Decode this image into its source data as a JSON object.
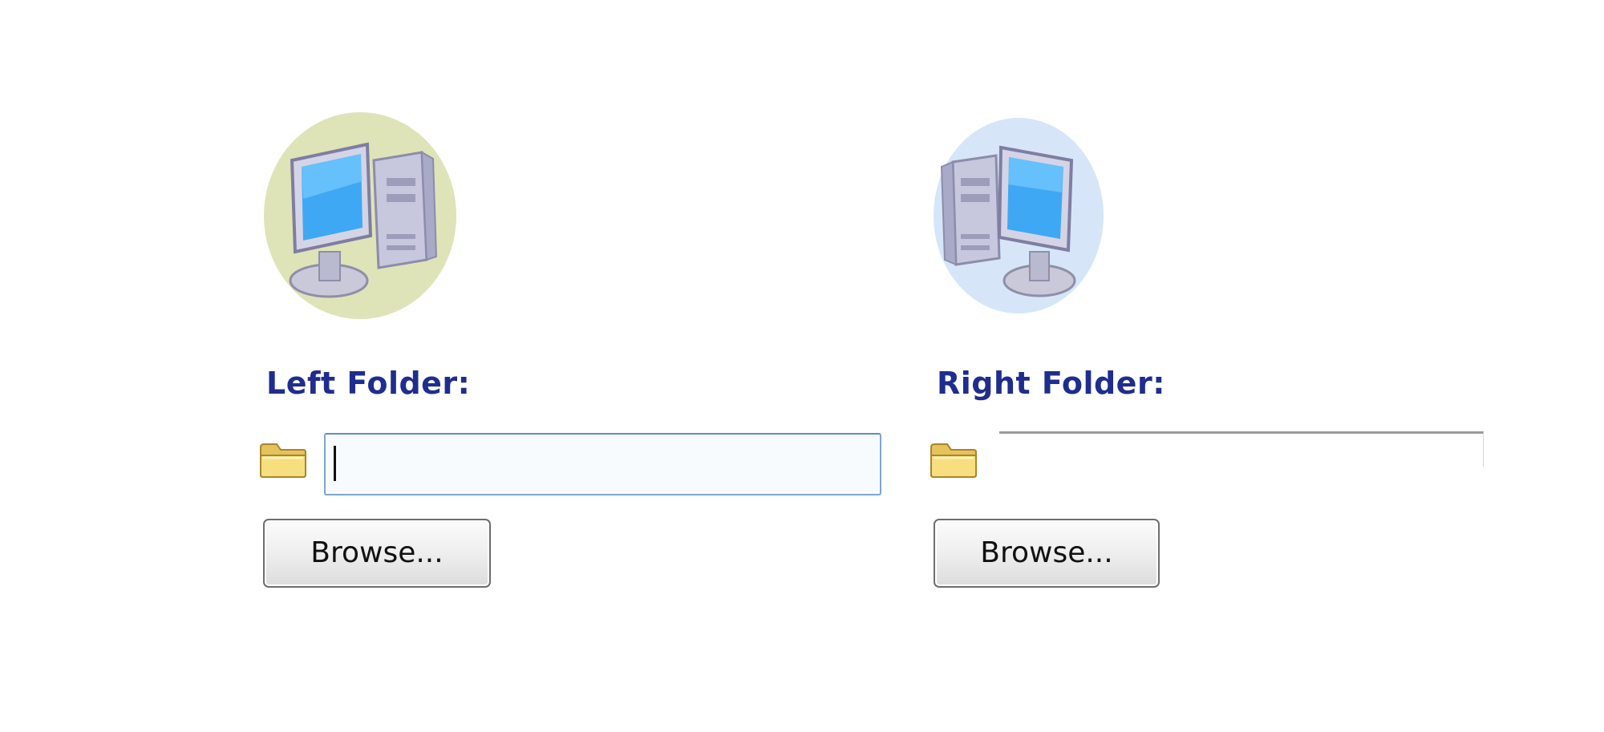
{
  "left_panel": {
    "label": "Left Folder:",
    "path_value": "",
    "browse_label": "Browse...",
    "icon": "computer-icon",
    "icon_halo_color": "#dfe3b8"
  },
  "right_panel": {
    "label": "Right Folder:",
    "path_value": "",
    "browse_label": "Browse...",
    "icon": "computer-icon",
    "icon_halo_color": "#d6e6f8"
  },
  "colors": {
    "label_text": "#1f2d8f",
    "input_border_focus": "#7fa6cf"
  }
}
